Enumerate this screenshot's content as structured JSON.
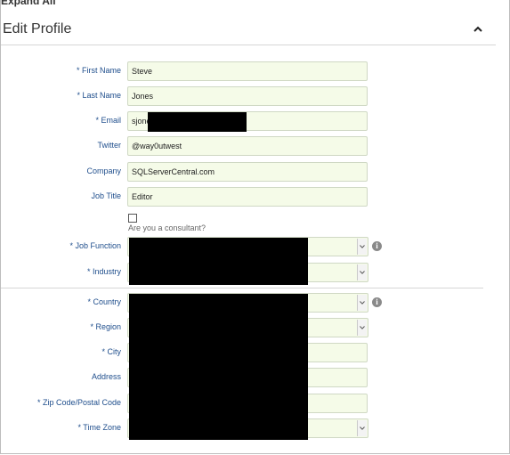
{
  "header": {
    "expand_all": "Expand All",
    "title": "Edit Profile"
  },
  "fields": {
    "first_name": {
      "label": "* First Name",
      "value": "Steve"
    },
    "last_name": {
      "label": "* Last Name",
      "value": "Jones"
    },
    "email": {
      "label": "* Email",
      "value": "sjone"
    },
    "twitter": {
      "label": "Twitter",
      "value": "@way0utwest"
    },
    "company": {
      "label": "Company",
      "value": "SQLServerCentral.com"
    },
    "job_title": {
      "label": "Job Title",
      "value": "Editor"
    },
    "consultant": {
      "label": "Are you a consultant?"
    },
    "job_function": {
      "label": "* Job Function"
    },
    "industry": {
      "label": "* Industry"
    },
    "country": {
      "label": "* Country"
    },
    "region": {
      "label": "* Region"
    },
    "city": {
      "label": "* City"
    },
    "address": {
      "label": "Address"
    },
    "zip": {
      "label": "* Zip Code/Postal Code"
    },
    "time_zone": {
      "label": "* Time Zone"
    }
  },
  "icons": {
    "collapse": "chevron-up-icon",
    "info": "info-icon",
    "dropdown": "chevron-down-icon"
  },
  "colors": {
    "label": "#1f4e8c",
    "input_bg": "#f5fbe8",
    "redaction": "#000000"
  }
}
